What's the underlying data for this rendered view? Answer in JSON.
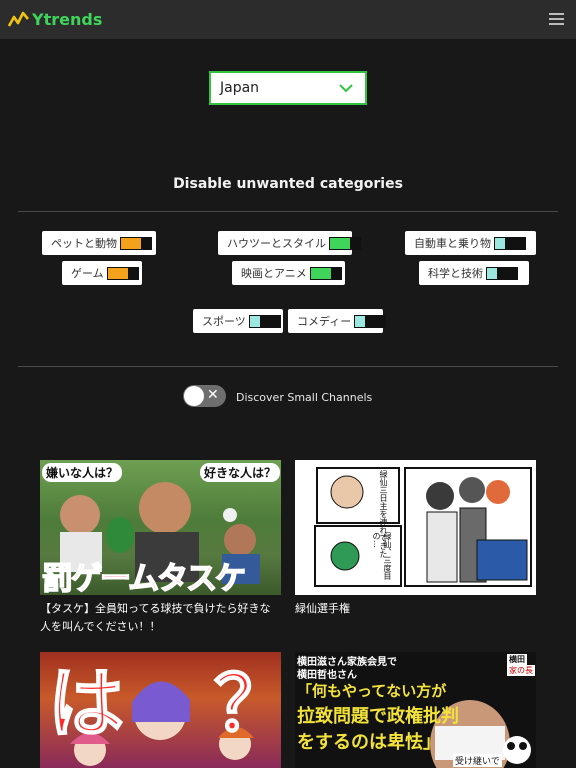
{
  "header": {
    "brand": "Ytrends",
    "brand_color": "#3fd45a",
    "menu_icon": "hamburger-icon"
  },
  "country_select": {
    "value": "Japan",
    "border_color": "#31c442"
  },
  "categories_section": {
    "title": "Disable unwanted categories",
    "items": [
      {
        "label": "ペットと動物",
        "colors": [
          "#f4a21c",
          "#f4a21c",
          "#111111"
        ]
      },
      {
        "label": "ハウツーとスタイル",
        "colors": [
          "#3fd45a",
          "#3fd45a",
          "#111111"
        ]
      },
      {
        "label": "自動車と乗り物",
        "colors": [
          "#9ce8e0",
          "#111111",
          "#111111"
        ]
      },
      {
        "label": "ゲーム",
        "colors": [
          "#f4a21c",
          "#f4a21c",
          "#111111"
        ]
      },
      {
        "label": "映画とアニメ",
        "colors": [
          "#3fd45a",
          "#3fd45a",
          "#111111"
        ]
      },
      {
        "label": "科学と技術",
        "colors": [
          "#9ce8e0",
          "#111111",
          "#111111"
        ]
      },
      {
        "label": "スポーツ",
        "colors": [
          "#9ce8e0",
          "#111111",
          "#111111"
        ]
      },
      {
        "label": "コメディー",
        "colors": [
          "#9ce8e0",
          "#111111",
          "#111111"
        ]
      }
    ]
  },
  "small_channels": {
    "label": "Discover Small Channels",
    "state": "off"
  },
  "videos": [
    {
      "title": "【タスケ】全員知ってる球技で負けたら好きな人を叫んでください！！",
      "thumb_text": [
        "嫌いな人は？",
        "好きな人は？",
        "罰ゲームタスケ"
      ]
    },
    {
      "title": "緑仙選手権",
      "thumb_text": [
        "緑仙三日主を連れてきた",
        "緑仙、三度目の…"
      ]
    },
    {
      "title": "",
      "thumb_text": [
        "は",
        "？"
      ]
    },
    {
      "title": "",
      "thumb_text": [
        "横田滋さん家族会見で",
        "横田哲也さん",
        "「何もやってない方が",
        "拉致問題で政権批判",
        "をするのは卑怯」",
        "受け継いで",
        "横田",
        "家の長"
      ]
    }
  ]
}
